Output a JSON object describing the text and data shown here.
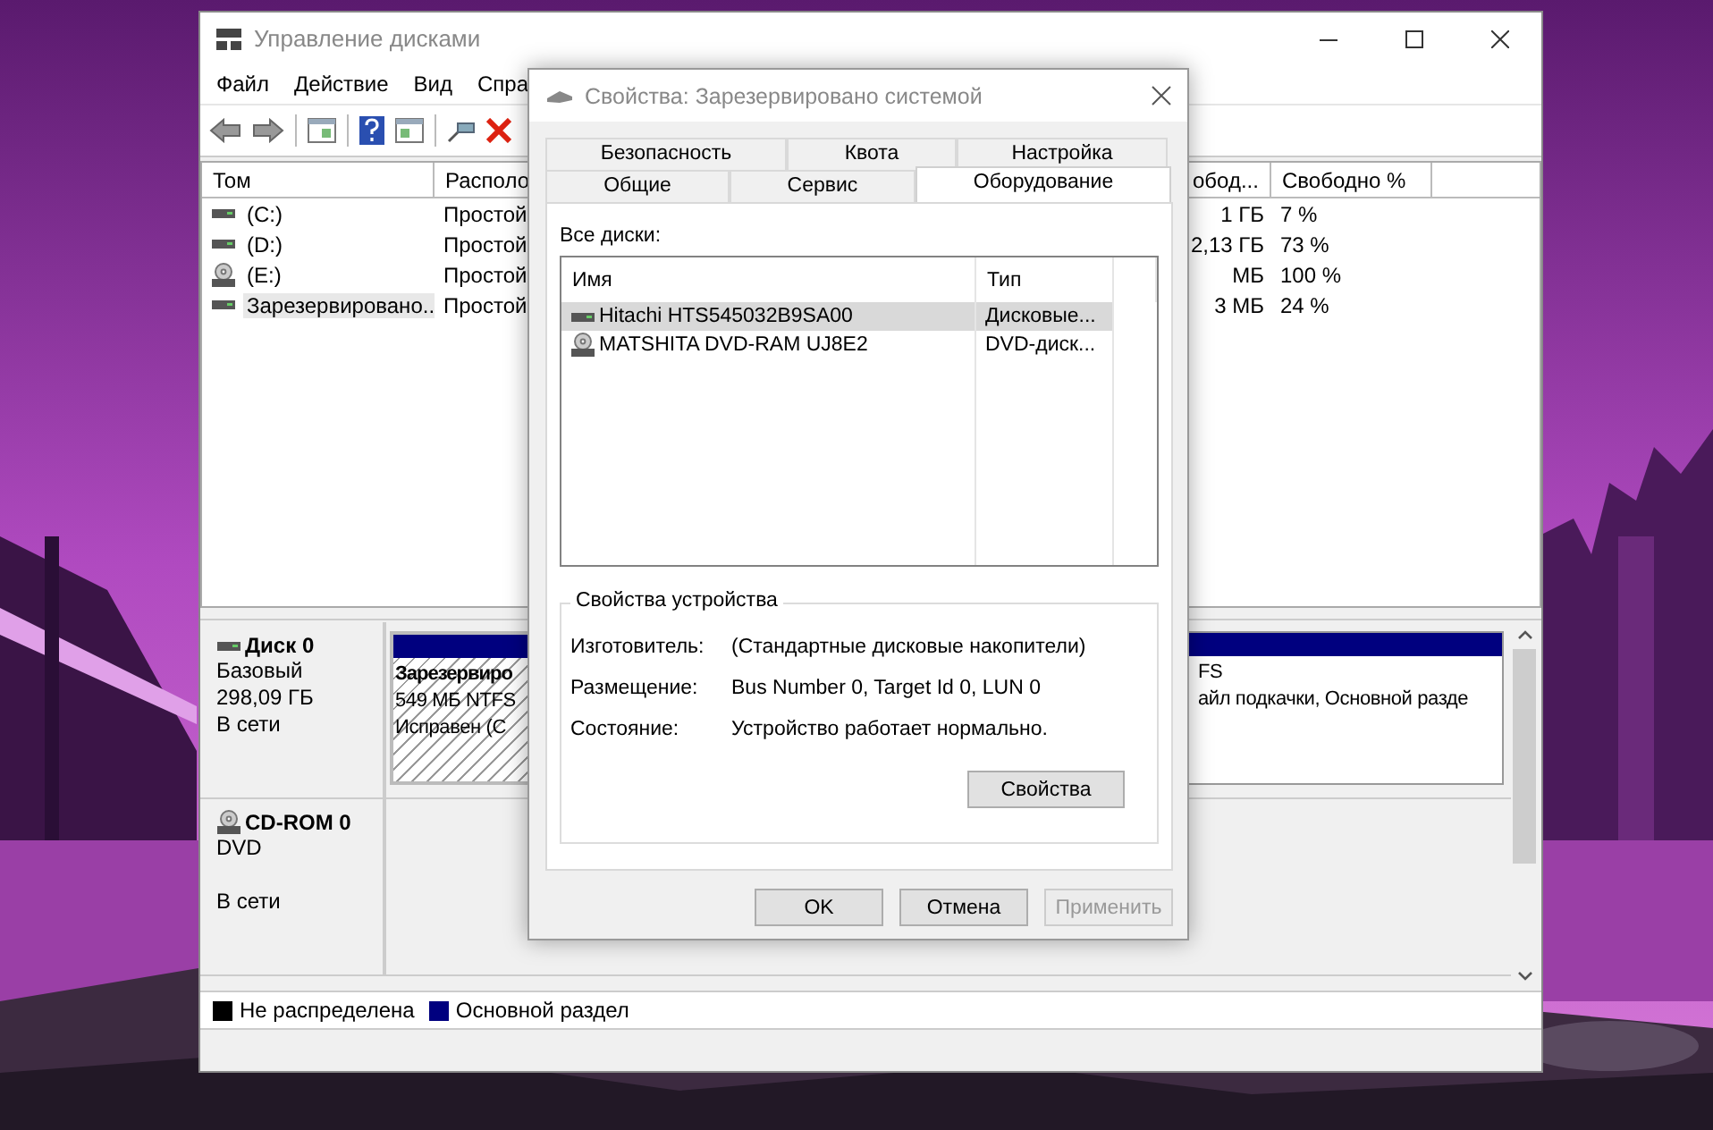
{
  "main_window": {
    "title": "Управление дисками",
    "menu": [
      "Файл",
      "Действие",
      "Вид",
      "Спра"
    ],
    "volumes": {
      "columns": [
        "Том",
        "Располо",
        "",
        "обод...",
        "Свободно %"
      ],
      "rows": [
        {
          "name": "(C:)",
          "kind": "disk",
          "layout": "Простой",
          "free": "1 ГБ",
          "free_pct": "7 %",
          "selected": false
        },
        {
          "name": "(D:)",
          "kind": "disk",
          "layout": "Простой",
          "free": "2,13 ГБ",
          "free_pct": "73 %",
          "selected": false
        },
        {
          "name": "(E:)",
          "kind": "cdrom",
          "layout": "Простой",
          "free": "МБ",
          "free_pct": "100 %",
          "selected": false
        },
        {
          "name": "Зарезервировано...",
          "kind": "disk",
          "layout": "Простой",
          "free": "3 МБ",
          "free_pct": "24 %",
          "selected": true
        }
      ]
    },
    "disks": [
      {
        "name": "Диск 0",
        "kind": "disk",
        "type": "Базовый",
        "size": "298,09 ГБ",
        "status": "В сети",
        "partitions": [
          {
            "lines": [
              "Зарезервиро",
              "549 МБ NTFS",
              "Исправен (С"
            ],
            "selected": true
          },
          {
            "lines": [
              "FS",
              "айл подкачки, Основной разде"
            ],
            "selected": false
          }
        ]
      },
      {
        "name": "CD-ROM 0",
        "kind": "cdrom",
        "type": "DVD",
        "status": "В сети"
      }
    ],
    "legend": [
      {
        "label": "Не распределена",
        "color": "#000000"
      },
      {
        "label": "Основной раздел",
        "color": "#00007f"
      }
    ]
  },
  "dialog": {
    "title": "Свойства: Зарезервировано системой",
    "tab_rows": [
      [
        {
          "label": "Безопасность",
          "selected": false
        },
        {
          "label": "Квота",
          "selected": false
        },
        {
          "label": "Настройка",
          "selected": false
        }
      ],
      [
        {
          "label": "Общие",
          "selected": false
        },
        {
          "label": "Сервис",
          "selected": false
        },
        {
          "label": "Оборудование",
          "selected": true
        }
      ]
    ],
    "all_disks_label": "Все диски:",
    "list": {
      "columns": [
        "Имя",
        "Тип"
      ],
      "rows": [
        {
          "name": "Hitachi HTS545032B9SA00",
          "type": "Дисковые...",
          "kind": "disk",
          "selected": true
        },
        {
          "name": "MATSHITA DVD-RAM UJ8E2",
          "type": "DVD-диск...",
          "kind": "cdrom",
          "selected": false
        }
      ]
    },
    "group_title": "Свойства устройства",
    "properties": [
      {
        "label": "Изготовитель:",
        "value": "(Стандартные дисковые накопители)"
      },
      {
        "label": "Размещение:",
        "value": "Bus Number 0, Target Id 0, LUN 0"
      },
      {
        "label": "Состояние:",
        "value": "Устройство работает нормально."
      }
    ],
    "properties_button": "Свойства",
    "buttons": [
      {
        "label": "OK",
        "disabled": false
      },
      {
        "label": "Отмена",
        "disabled": false
      },
      {
        "label": "Применить",
        "disabled": true
      }
    ]
  }
}
